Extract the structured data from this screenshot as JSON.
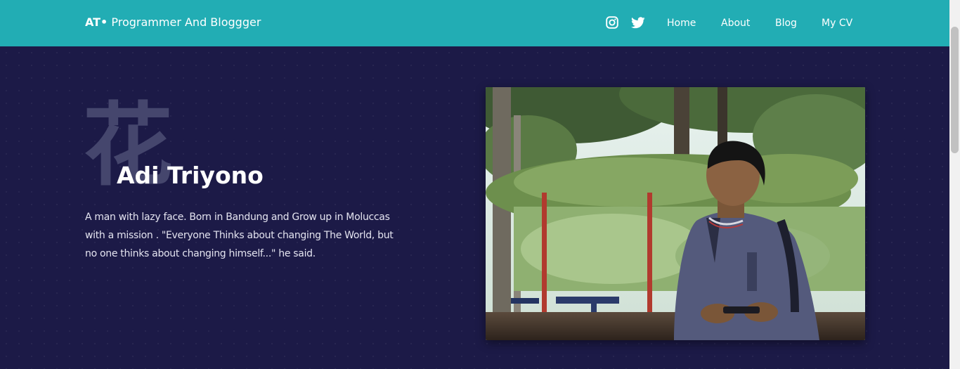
{
  "navbar": {
    "brand_mark": "AT•",
    "brand_text": "Programmer And Bloggger",
    "links": [
      {
        "label": "Home"
      },
      {
        "label": "About"
      },
      {
        "label": "Blog"
      },
      {
        "label": "My CV"
      }
    ],
    "social_icons": [
      "instagram-icon",
      "twitter-icon"
    ]
  },
  "hero": {
    "kanji": "花",
    "name": "Adi Triyono",
    "bio": "A man with lazy face. Born in Bandung and Grow up in Moluccas with a mission . \"Everyone Thinks about changing The World, but no one thinks about changing himself...\" he said."
  },
  "colors": {
    "navbar": "#22adb4",
    "background": "#1c1a47",
    "kanji": "#45466d",
    "text": "#ffffff"
  }
}
